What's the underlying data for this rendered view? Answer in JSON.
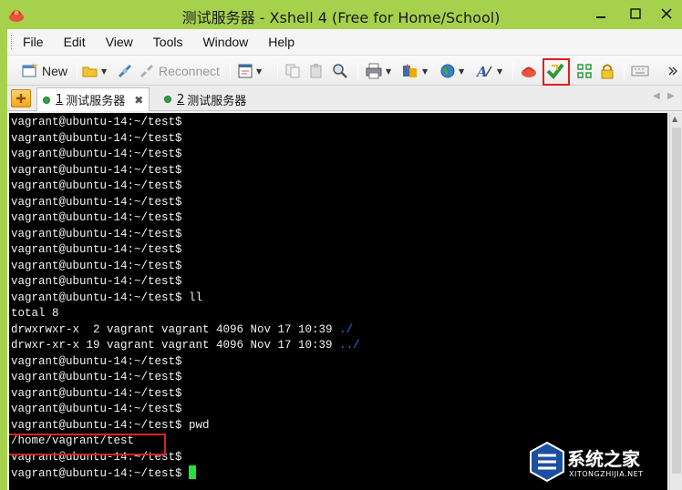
{
  "window": {
    "title": "测试服务器 - Xshell 4 (Free for Home/School)"
  },
  "menu": {
    "items": [
      "File",
      "Edit",
      "View",
      "Tools",
      "Window",
      "Help"
    ]
  },
  "toolbar": {
    "new_label": "New",
    "reconnect_label": "Reconnect"
  },
  "tabs": [
    {
      "number": "1",
      "label": "测试服务器",
      "active": true
    },
    {
      "number": "2",
      "label": "测试服务器",
      "active": false
    }
  ],
  "terminal": {
    "prompt": "vagrant@ubuntu-14:~/test$",
    "lines": [
      "vagrant@ubuntu-14:~/test$",
      "vagrant@ubuntu-14:~/test$",
      "vagrant@ubuntu-14:~/test$",
      "vagrant@ubuntu-14:~/test$",
      "vagrant@ubuntu-14:~/test$",
      "vagrant@ubuntu-14:~/test$",
      "vagrant@ubuntu-14:~/test$",
      "vagrant@ubuntu-14:~/test$",
      "vagrant@ubuntu-14:~/test$",
      "vagrant@ubuntu-14:~/test$",
      "vagrant@ubuntu-14:~/test$",
      "vagrant@ubuntu-14:~/test$ ll",
      "total 8",
      "drwxrwxr-x  2 vagrant vagrant 4096 Nov 17 10:39 ",
      "drwxr-xr-x 19 vagrant vagrant 4096 Nov 17 10:39 ",
      "vagrant@ubuntu-14:~/test$",
      "vagrant@ubuntu-14:~/test$",
      "vagrant@ubuntu-14:~/test$",
      "vagrant@ubuntu-14:~/test$",
      "vagrant@ubuntu-14:~/test$ pwd",
      "/home/vagrant/test",
      "vagrant@ubuntu-14:~/test$",
      "vagrant@ubuntu-14:~/test$ "
    ],
    "dir_entries": [
      "./",
      "../"
    ]
  },
  "watermark": {
    "text": "系统之家",
    "sub": "XITONGZHIJIA.NET"
  },
  "colors": {
    "frame": "#a6d14d",
    "terminal_bg": "#000000",
    "terminal_fg": "#f2f2f2",
    "dir": "#2a6bff",
    "cursor": "#22e03a",
    "highlight": "#e02020"
  }
}
